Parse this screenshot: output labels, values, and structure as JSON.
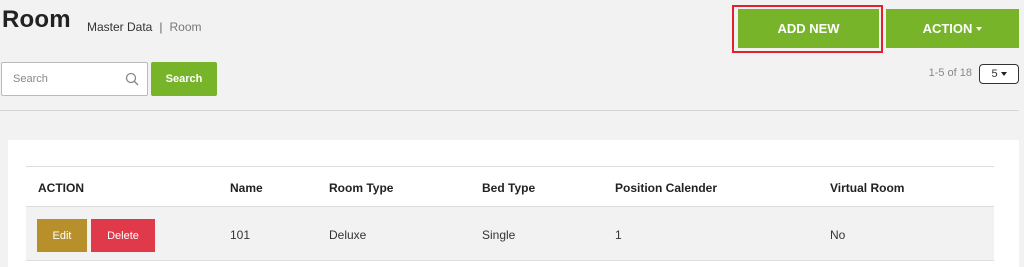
{
  "header": {
    "title": "Room",
    "breadcrumb": {
      "parent": "Master Data",
      "separator": "|",
      "current": "Room"
    },
    "add_new_label": "ADD NEW",
    "action_label": "ACTION"
  },
  "search": {
    "placeholder": "Search",
    "value": "",
    "button_label": "Search"
  },
  "pagination": {
    "range_text": "1-5 of 18",
    "per_page": "5"
  },
  "table": {
    "columns": [
      "ACTION",
      "Name",
      "Room Type",
      "Bed Type",
      "Position Calender",
      "Virtual Room"
    ],
    "rows": [
      {
        "edit_label": "Edit",
        "delete_label": "Delete",
        "name": "101",
        "room_type": "Deluxe",
        "bed_type": "Single",
        "position_calender": "1",
        "virtual_room": "No"
      }
    ]
  },
  "colors": {
    "primary_green": "#77b42a",
    "highlight_red": "#e3212b",
    "edit_gold": "#b8902b",
    "delete_red": "#e03a4a"
  }
}
